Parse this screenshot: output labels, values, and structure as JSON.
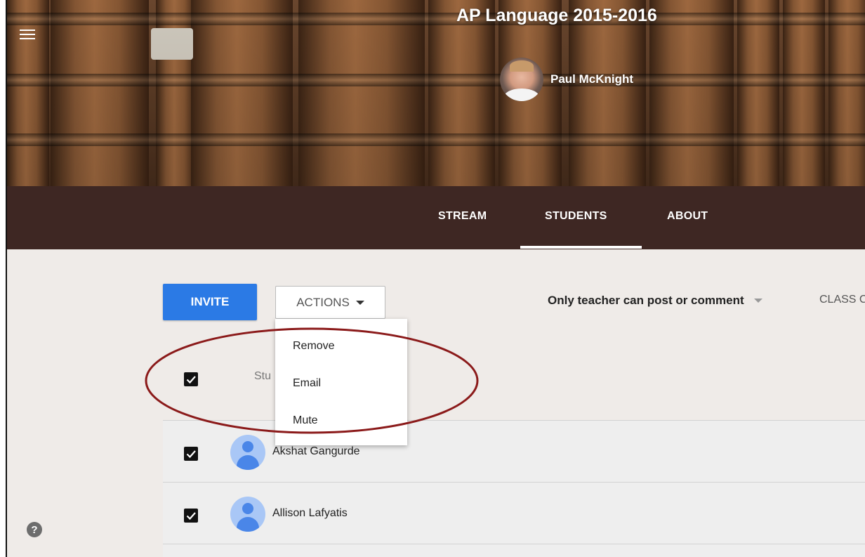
{
  "header": {
    "class_title": "AP Language 2015-2016",
    "teacher_name": "Paul McKnight",
    "menu_icon": "hamburger-menu-icon"
  },
  "tabs": [
    {
      "label": "STREAM",
      "active": false
    },
    {
      "label": "STUDENTS",
      "active": true
    },
    {
      "label": "ABOUT",
      "active": false
    }
  ],
  "toolbar": {
    "invite_label": "INVITE",
    "actions_label": "ACTIONS",
    "post_setting_label": "Only teacher can post or comment",
    "class_code_label": "CLASS C"
  },
  "actions_menu": {
    "items": [
      "Remove",
      "Email",
      "Mute"
    ]
  },
  "list_header": {
    "label": "Stu",
    "select_all_checked": true
  },
  "students": [
    {
      "name": "Akshat Gangurde",
      "checked": true
    },
    {
      "name": "Allison Lafyatis",
      "checked": true
    }
  ],
  "help": {
    "label": "?"
  },
  "colors": {
    "tab_bar": "#3e2723",
    "invite_button": "#2b7ae5",
    "page_background": "#efebe8",
    "annotation_ellipse": "#8b1a1a"
  }
}
